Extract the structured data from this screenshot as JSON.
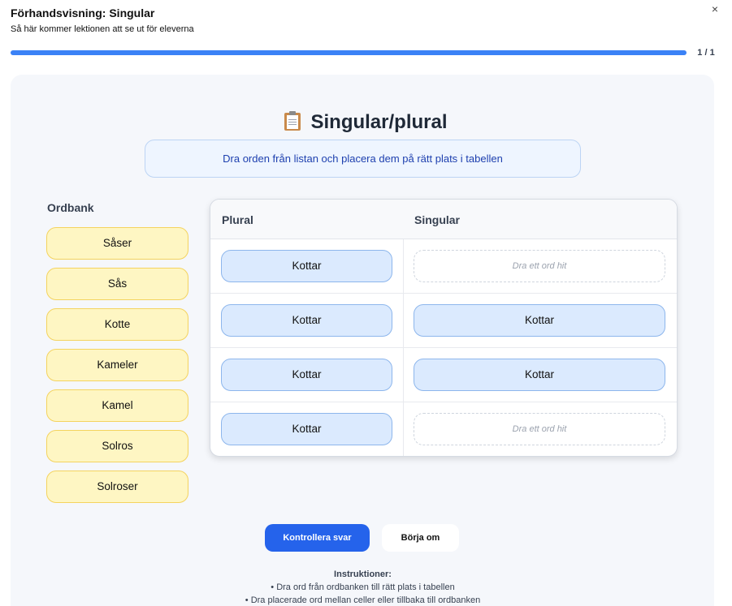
{
  "header": {
    "title": "Förhandsvisning: Singular",
    "subtitle": "Så här kommer lektionen att se ut för eleverna",
    "close_icon": "×"
  },
  "progress": {
    "value": 1.0,
    "label": "1 / 1"
  },
  "lesson": {
    "title": "Singular/plural",
    "title_icon": "clipboard-icon",
    "instruction": "Dra orden från listan och placera dem på rätt plats i tabellen"
  },
  "wordbank": {
    "label": "Ordbank",
    "words": [
      "Såser",
      "Sås",
      "Kotte",
      "Kameler",
      "Kamel",
      "Solros",
      "Solroser"
    ]
  },
  "table": {
    "headers": [
      "Plural",
      "Singular"
    ],
    "placeholder": "Dra ett ord hit",
    "rows": [
      {
        "plural": "Kottar",
        "singular": ""
      },
      {
        "plural": "Kottar",
        "singular": "Kottar"
      },
      {
        "plural": "Kottar",
        "singular": "Kottar"
      },
      {
        "plural": "Kottar",
        "singular": ""
      }
    ]
  },
  "actions": {
    "check": "Kontrollera svar",
    "reset": "Börja om"
  },
  "help": {
    "title": "Instruktioner:",
    "lines": [
      "• Dra ord från ordbanken till rätt plats i tabellen",
      "• Dra placerade ord mellan celler eller tillbaka till ordbanken"
    ]
  },
  "colors": {
    "accent": "#2563eb",
    "progress": "#3b82f6",
    "chip_fill": "#fef6c3",
    "cell_fill": "#dbeafe"
  }
}
